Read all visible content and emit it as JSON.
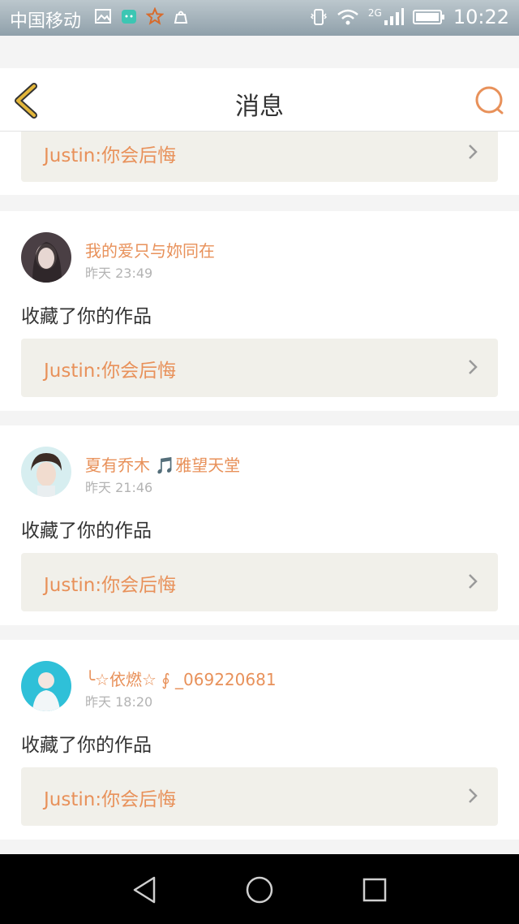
{
  "status_bar": {
    "carrier": "中国移动",
    "network": "2G",
    "time": "10:22"
  },
  "header": {
    "title": "消息"
  },
  "feed": {
    "top_partial_work": "Justin:你会后悔",
    "items": [
      {
        "username": "我的爱只与妳同在",
        "time": "昨天 23:49",
        "action": "收藏了你的作品",
        "work": "Justin:你会后悔"
      },
      {
        "username": "夏有乔木 🎵雅望天堂",
        "time": "昨天 21:46",
        "action": "收藏了你的作品",
        "work": "Justin:你会后悔"
      },
      {
        "username": "╰☆依燃☆ ∮ _069220681",
        "time": "昨天 18:20",
        "action": "收藏了你的作品",
        "work": "Justin:你会后悔"
      }
    ]
  },
  "colors": {
    "accent": "#e8915a",
    "back_icon": "#e3b63a",
    "card_link_bg": "#f1f0ea"
  }
}
